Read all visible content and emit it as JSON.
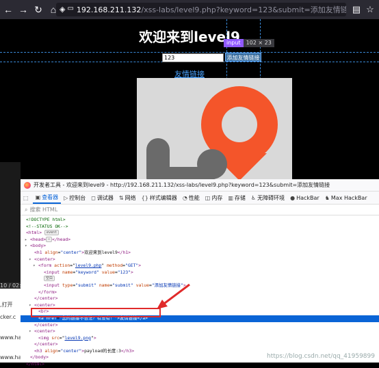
{
  "browser": {
    "url_host": "192.168.211.132",
    "url_path": "/xss-labs/level9.php?keyword=123&submit=添加友情链接"
  },
  "page": {
    "title": "欢迎来到level9",
    "keyword_value": "123",
    "submit_label": "添加友情链接",
    "link_text": "友情链接",
    "inspect_tag": "input",
    "inspect_size": "102 × 23"
  },
  "left_strip": {
    "time": "10 / 02:",
    "line1": ",打开",
    "line2": "cker.c",
    "line3": "www.hac",
    "line4": "www.ha"
  },
  "devtools": {
    "window_title": "开发者工具 - 欢迎来到level9 - http://192.168.211.132/xss-labs/level9.php?keyword=123&submit=添加友情链接",
    "tabs": [
      "查看器",
      "控制台",
      "调试器",
      "网络",
      "样式编辑器",
      "性能",
      "内存",
      "存储",
      "无障碍环境",
      "HackBar",
      "Max HackBar"
    ],
    "search_placeholder": "搜索 HTML",
    "event_badge": "event",
    "ellipsis_badge": "⋯",
    "blank_badge": "空白",
    "nodes": {
      "doctype": "<!DOCTYPE html>",
      "status_comment": "<!--STATUS OK-->",
      "html_open": "<html>",
      "head": "<head>",
      "head_close": "</head>",
      "body_open": "<body>",
      "h1_prefix": "<h1 ",
      "h1_attr": "align",
      "h1_val": "\"center\"",
      "h1_text": "欢迎来到level9",
      "h1_close": "</h1>",
      "center_open": "<center>",
      "form_prefix": "<form ",
      "form_attr1": "action",
      "form_val1": "level9.php",
      "form_attr2": "method",
      "form_val2": "\"GET\"",
      "form_end": ">",
      "input1_prefix": "<input ",
      "input1_attr1": "name",
      "input1_val1": "\"keyword\"",
      "input1_attr2": "value",
      "input1_val2": "\"123\"",
      "input2_prefix": "<input ",
      "input2_attr1": "type",
      "input2_val1": "\"submit\"",
      "input2_attr2": "name",
      "input2_val2": "\"submit\"",
      "input2_attr3": "value",
      "input2_val3": "\"添加友情链接\"",
      "form_close": "</form>",
      "center_close": "</center>",
      "br": "<br>",
      "a_prefix": "<a ",
      "a_attr": "href",
      "a_val": "\"您的链接不合法？有没有！\"",
      "a_text": "友情链接",
      "a_close": "</a>",
      "img_prefix": "<img ",
      "img_attr": "src",
      "img_val": "level9.png",
      "h3_prefix": "<h3 ",
      "h3_attr": "align",
      "h3_val": "\"center\"",
      "h3_text": "payload的长度:3",
      "h3_close": "</h3>",
      "body_close": "</body>",
      "html_close": "</html>"
    }
  },
  "watermark": "https://blog.csdn.net/qq_41959899",
  "colors": {
    "accent": "#0a64d6",
    "annotation": "#e02a2a",
    "logo_orange": "#f4552a",
    "logo_gray": "#6a6a6a"
  }
}
